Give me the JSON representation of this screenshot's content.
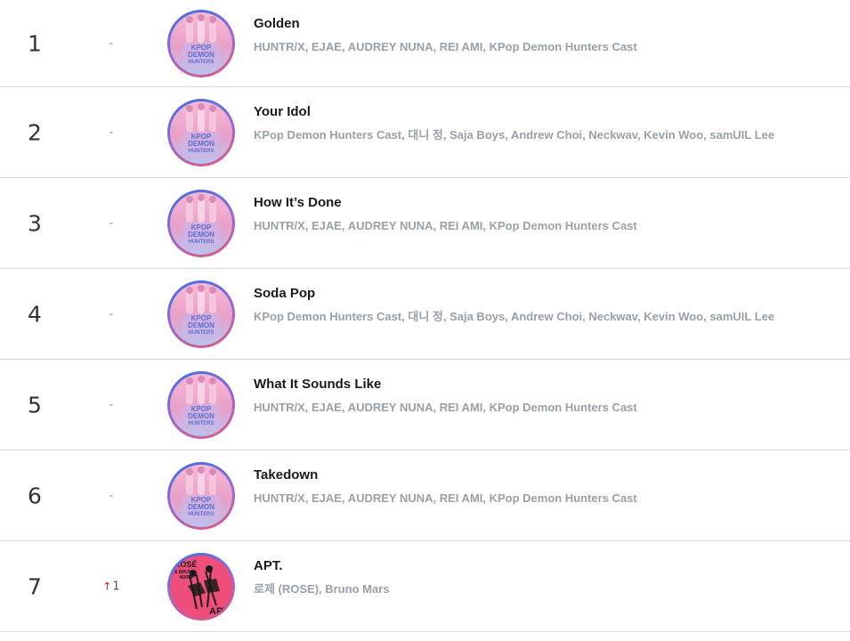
{
  "chart": {
    "rows": [
      {
        "rank": "1",
        "change": "-",
        "title": "Golden",
        "artists": "HUNTR/X, EJAE, AUDREY NUNA, REI AMI, KPop Demon Hunters Cast",
        "cover_art": "kpop-demon-hunters-cover",
        "cover_text": [
          "KPOP",
          "DEMON",
          "HUNTERS"
        ]
      },
      {
        "rank": "2",
        "change": "-",
        "title": "Your Idol",
        "artists": "KPop Demon Hunters Cast, 대니 정, Saja Boys, Andrew Choi, Neckwav, Kevin Woo, samUIL Lee",
        "cover_art": "kpop-demon-hunters-cover",
        "cover_text": [
          "KPOP",
          "DEMON",
          "HUNTERS"
        ]
      },
      {
        "rank": "3",
        "change": "-",
        "title": "How It’s Done",
        "artists": "HUNTR/X, EJAE, AUDREY NUNA, REI AMI, KPop Demon Hunters Cast",
        "cover_art": "kpop-demon-hunters-cover",
        "cover_text": [
          "KPOP",
          "DEMON",
          "HUNTERS"
        ]
      },
      {
        "rank": "4",
        "change": "-",
        "title": "Soda Pop",
        "artists": "KPop Demon Hunters Cast, 대니 정, Saja Boys, Andrew Choi, Neckwav, Kevin Woo, samUIL Lee",
        "cover_art": "kpop-demon-hunters-cover",
        "cover_text": [
          "KPOP",
          "DEMON",
          "HUNTERS"
        ]
      },
      {
        "rank": "5",
        "change": "-",
        "title": "What It Sounds Like",
        "artists": "HUNTR/X, EJAE, AUDREY NUNA, REI AMI, KPop Demon Hunters Cast",
        "cover_art": "kpop-demon-hunters-cover",
        "cover_text": [
          "KPOP",
          "DEMON",
          "HUNTERS"
        ]
      },
      {
        "rank": "6",
        "change": "-",
        "title": "Takedown",
        "artists": "HUNTR/X, EJAE, AUDREY NUNA, REI AMI, KPop Demon Hunters Cast",
        "cover_art": "kpop-demon-hunters-cover",
        "cover_text": [
          "KPOP",
          "DEMON",
          "HUNTERS"
        ]
      },
      {
        "rank": "7",
        "change": "1",
        "change_direction": "up",
        "change_icon": "up-arrow-icon",
        "title": "APT.",
        "artists": "로제 (ROSE), Bruno Mars",
        "cover_art": "apt-cover",
        "cover_text": [
          "ROSÉ",
          "& BRUNO",
          "MARS",
          "APT"
        ]
      }
    ]
  },
  "colors": {
    "up_arrow": "#e02020",
    "artist_text": "#9aa0a8",
    "title_text": "#1a1a1a",
    "divider": "#d9d9d9",
    "cover_ring_start": "#3b6fe0",
    "cover_ring_end": "#e85a7a",
    "apt_cover_bg": "#ee4f7a"
  }
}
